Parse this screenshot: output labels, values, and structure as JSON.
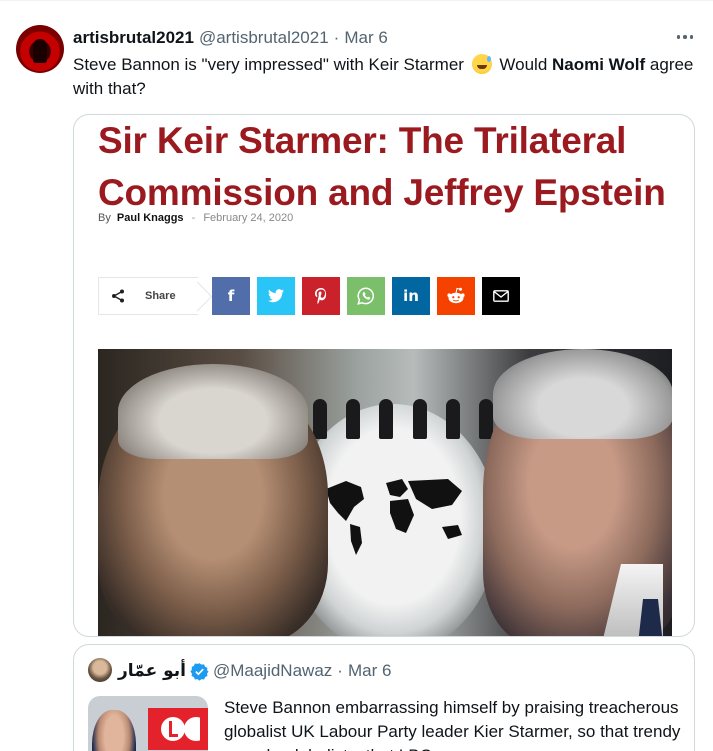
{
  "tweet": {
    "display_name": "artisbrutal2021",
    "handle": "@artisbrutal2021",
    "separator": "·",
    "date": "Mar 6",
    "text_part1": "Steve Bannon is \"very impressed\" with Keir Starmer ",
    "emoji": "grinning-sweat-emoji",
    "text_part2": " Would ",
    "text_bold": "Naomi Wolf",
    "text_part3": " agree with that?"
  },
  "article": {
    "title": "Sir Keir Starmer: The Trilateral Commission and Jeffrey Epstein",
    "by_label": "By",
    "author": "Paul Knaggs",
    "separator": "-",
    "date": "February 24, 2020",
    "share_label": "Share",
    "share_buttons": [
      {
        "name": "facebook",
        "glyph": "f",
        "color": "#516eab"
      },
      {
        "name": "twitter",
        "glyph": "",
        "color": "#29c5f6"
      },
      {
        "name": "pinterest",
        "glyph": "P",
        "color": "#ca212a"
      },
      {
        "name": "whatsapp",
        "glyph": "",
        "color": "#7bbf6a"
      },
      {
        "name": "linkedin",
        "glyph": "in",
        "color": "#0266a0"
      },
      {
        "name": "reddit",
        "glyph": "",
        "color": "#f54200"
      },
      {
        "name": "email",
        "glyph": "",
        "color": "#000000"
      }
    ]
  },
  "quote": {
    "display_name": "أبو عمّار",
    "handle": "@MaajidNawaz",
    "separator": "·",
    "date": "Mar 6",
    "text": "Steve Bannon embarrassing himself by praising treacherous globalist UK Labour Party leader Kier Starmer, so that trendy pseudo-globalists, that LBC"
  },
  "colors": {
    "title_red": "#9b1a1f",
    "verified_blue": "#1d9bf0",
    "muted": "#536471"
  }
}
